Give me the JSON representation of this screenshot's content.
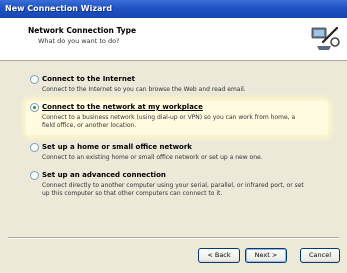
{
  "window": {
    "title": "New Connection Wizard"
  },
  "header": {
    "title": "Network Connection Type",
    "subtitle": "What do you want to do?",
    "icon": "network-wizard-icon"
  },
  "options": [
    {
      "label": "Connect to the Internet",
      "description": "Connect to the Internet so you can browse the Web and read email.",
      "selected": false
    },
    {
      "label": "Connect to the network at my workplace",
      "description": "Connect to a business network (using dial-up or VPN) so you can work from home, a field office, or another location.",
      "selected": true
    },
    {
      "label": "Set up a home or small office network",
      "description": "Connect to an existing home or small office network or set up a new one.",
      "selected": false
    },
    {
      "label": "Set up an advanced connection",
      "description": "Connect directly to another computer using your serial, parallel, or infrared port, or set up this computer so that other computers can connect to it.",
      "selected": false
    }
  ],
  "buttons": {
    "back": "< Back",
    "next": "Next >",
    "cancel": "Cancel"
  },
  "colors": {
    "titlebar": "#1f52c4",
    "dialog_bg": "#ece9d8",
    "selection_highlight": "#fffbe0",
    "radio_dot": "#2a9a2a"
  }
}
